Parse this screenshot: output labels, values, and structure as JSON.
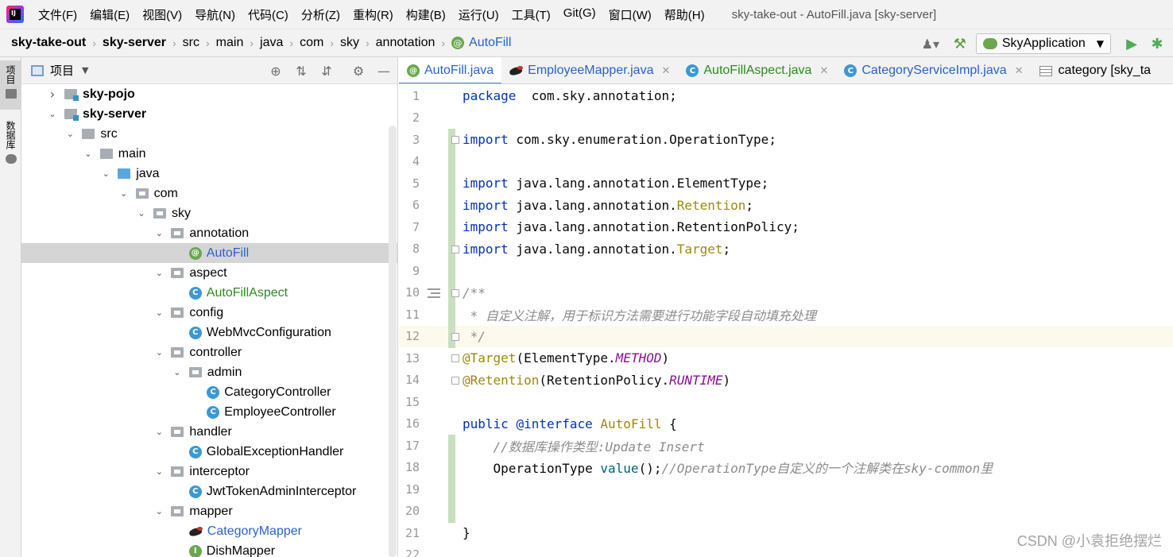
{
  "menubar": {
    "items": [
      "文件(F)",
      "编辑(E)",
      "视图(V)",
      "导航(N)",
      "代码(C)",
      "分析(Z)",
      "重构(R)",
      "构建(B)",
      "运行(U)",
      "工具(T)",
      "Git(G)",
      "窗口(W)",
      "帮助(H)"
    ],
    "window_title": "sky-take-out - AutoFill.java [sky-server]"
  },
  "breadcrumb": [
    "sky-take-out",
    "sky-server",
    "src",
    "main",
    "java",
    "com",
    "sky",
    "annotation",
    "AutoFill"
  ],
  "toolbar": {
    "run_config": "SkyApplication"
  },
  "side_strip": {
    "project_label": "项目",
    "database_label": "数据库"
  },
  "project_panel": {
    "title": "项目",
    "tree": [
      {
        "label": "sky-pojo",
        "depth": 1,
        "arrow": "›",
        "icon": "module",
        "style": "bold"
      },
      {
        "label": "sky-server",
        "depth": 1,
        "arrow": "⌄",
        "icon": "module",
        "style": "bold"
      },
      {
        "label": "src",
        "depth": 2,
        "arrow": "⌄",
        "icon": "src"
      },
      {
        "label": "main",
        "depth": 3,
        "arrow": "⌄",
        "icon": "plain"
      },
      {
        "label": "java",
        "depth": 4,
        "arrow": "⌄",
        "icon": "java"
      },
      {
        "label": "com",
        "depth": 5,
        "arrow": "⌄",
        "icon": "pkg"
      },
      {
        "label": "sky",
        "depth": 6,
        "arrow": "⌄",
        "icon": "pkg"
      },
      {
        "label": "annotation",
        "depth": 7,
        "arrow": "⌄",
        "icon": "pkg"
      },
      {
        "label": "AutoFill",
        "depth": 8,
        "arrow": "",
        "icon": "anno",
        "style": "blue",
        "selected": true
      },
      {
        "label": "aspect",
        "depth": 7,
        "arrow": "⌄",
        "icon": "pkg"
      },
      {
        "label": "AutoFillAspect",
        "depth": 8,
        "arrow": "",
        "icon": "class",
        "style": "green"
      },
      {
        "label": "config",
        "depth": 7,
        "arrow": "⌄",
        "icon": "pkg"
      },
      {
        "label": "WebMvcConfiguration",
        "depth": 8,
        "arrow": "",
        "icon": "class"
      },
      {
        "label": "controller",
        "depth": 7,
        "arrow": "⌄",
        "icon": "pkg"
      },
      {
        "label": "admin",
        "depth": 8,
        "arrow": "⌄",
        "icon": "pkg"
      },
      {
        "label": "CategoryController",
        "depth": 9,
        "arrow": "",
        "icon": "class"
      },
      {
        "label": "EmployeeController",
        "depth": 9,
        "arrow": "",
        "icon": "class"
      },
      {
        "label": "handler",
        "depth": 7,
        "arrow": "⌄",
        "icon": "pkg"
      },
      {
        "label": "GlobalExceptionHandler",
        "depth": 8,
        "arrow": "",
        "icon": "class"
      },
      {
        "label": "interceptor",
        "depth": 7,
        "arrow": "⌄",
        "icon": "pkg"
      },
      {
        "label": "JwtTokenAdminInterceptor",
        "depth": 8,
        "arrow": "",
        "icon": "class"
      },
      {
        "label": "mapper",
        "depth": 7,
        "arrow": "⌄",
        "icon": "pkg"
      },
      {
        "label": "CategoryMapper",
        "depth": 8,
        "arrow": "",
        "icon": "mybatis",
        "style": "blue"
      },
      {
        "label": "DishMapper",
        "depth": 8,
        "arrow": "",
        "icon": "iface"
      }
    ]
  },
  "editor": {
    "tabs": [
      {
        "label": "AutoFill.java",
        "icon": "anno",
        "style": "blue",
        "active": true,
        "closable": false
      },
      {
        "label": "EmployeeMapper.java",
        "icon": "mybatis",
        "style": "blue",
        "closable": true
      },
      {
        "label": "AutoFillAspect.java",
        "icon": "class",
        "style": "green",
        "closable": true
      },
      {
        "label": "CategoryServiceImpl.java",
        "icon": "class",
        "style": "blue",
        "closable": true
      },
      {
        "label": "category [sky_ta",
        "icon": "table",
        "style": "",
        "closable": false
      }
    ],
    "current_line": 12,
    "lines": [
      {
        "n": "1",
        "tokens": [
          [
            "kw",
            "package"
          ],
          [
            "",
            "  com.sky.annotation;"
          ]
        ]
      },
      {
        "n": "2",
        "tokens": []
      },
      {
        "n": "3",
        "tokens": [
          [
            "kw",
            "import"
          ],
          [
            "",
            " com.sky.enumeration.OperationType;"
          ]
        ]
      },
      {
        "n": "4",
        "tokens": []
      },
      {
        "n": "5",
        "tokens": [
          [
            "kw",
            "import"
          ],
          [
            "",
            " java.lang.annotation.ElementType;"
          ]
        ]
      },
      {
        "n": "6",
        "tokens": [
          [
            "kw",
            "import"
          ],
          [
            "",
            " java.lang.annotation."
          ],
          [
            "ret",
            "Retention"
          ],
          [
            "",
            ";"
          ]
        ]
      },
      {
        "n": "7",
        "tokens": [
          [
            "kw",
            "import"
          ],
          [
            "",
            " java.lang.annotation.RetentionPolicy;"
          ]
        ]
      },
      {
        "n": "8",
        "tokens": [
          [
            "kw",
            "import"
          ],
          [
            "",
            " java.lang.annotation."
          ],
          [
            "ret",
            "Target"
          ],
          [
            "",
            ";"
          ]
        ]
      },
      {
        "n": "9",
        "tokens": []
      },
      {
        "n": "10",
        "tokens": [
          [
            "cm",
            "/**"
          ]
        ]
      },
      {
        "n": "11",
        "tokens": [
          [
            "cm",
            " * 自定义注解，用于标识方法需要进行功能字段自动填充处理"
          ]
        ]
      },
      {
        "n": "12",
        "tokens": [
          [
            "cm",
            " */"
          ]
        ]
      },
      {
        "n": "13",
        "tokens": [
          [
            "ann",
            "@Target"
          ],
          [
            "",
            "(ElementType."
          ],
          [
            "enum",
            "METHOD"
          ],
          [
            "",
            ")"
          ]
        ]
      },
      {
        "n": "14",
        "tokens": [
          [
            "ann",
            "@Retention"
          ],
          [
            "",
            "(RetentionPolicy."
          ],
          [
            "enum",
            "RUNTIME"
          ],
          [
            "",
            ")"
          ]
        ]
      },
      {
        "n": "15",
        "tokens": []
      },
      {
        "n": "16",
        "tokens": [
          [
            "kw",
            "public"
          ],
          [
            "",
            " "
          ],
          [
            "kw",
            "@interface"
          ],
          [
            "",
            " "
          ],
          [
            "ret",
            "AutoFill"
          ],
          [
            "",
            " {"
          ]
        ]
      },
      {
        "n": "17",
        "tokens": [
          [
            "",
            "    "
          ],
          [
            "cm",
            "//数据库操作类型:Update Insert"
          ]
        ]
      },
      {
        "n": "18",
        "tokens": [
          [
            "",
            "    OperationType "
          ],
          [
            "method",
            "value"
          ],
          [
            "",
            "();"
          ],
          [
            "cm",
            "//OperationType自定义的一个注解类在sky-common里"
          ]
        ]
      },
      {
        "n": "19",
        "tokens": []
      },
      {
        "n": "20",
        "tokens": []
      },
      {
        "n": "21",
        "tokens": [
          [
            "",
            "}"
          ]
        ]
      },
      {
        "n": "22",
        "tokens": []
      }
    ]
  },
  "watermark": "CSDN @小袁拒绝摆烂"
}
